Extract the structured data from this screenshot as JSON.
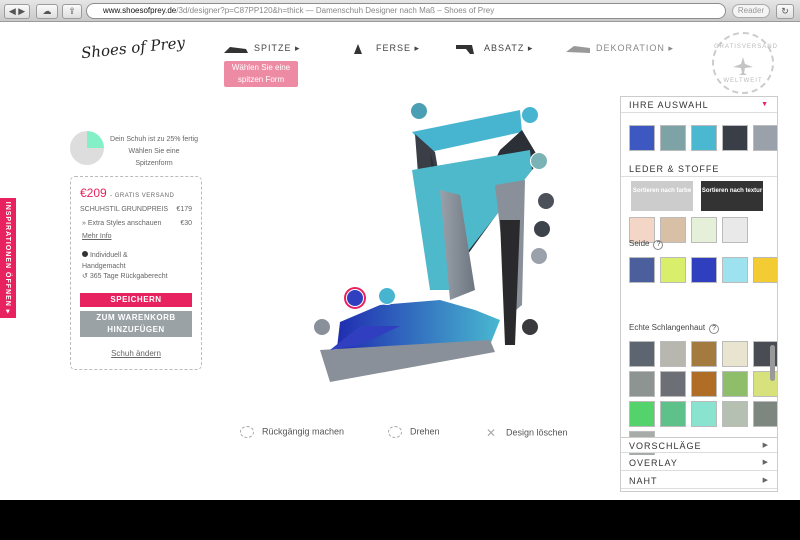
{
  "browser": {
    "url_domain": "www.shoesofprey.de",
    "url_path": "/3d/designer?p=C87PP120&h=thick",
    "page_title": "— Damenschuh Designer nach Maß – Shoes of Prey",
    "reader_label": "Reader"
  },
  "logo": {
    "text": "Shoes of Prey"
  },
  "steps": [
    {
      "label": "SPITZE ▸"
    },
    {
      "label": "FERSE ▸"
    },
    {
      "label": "ABSATZ ▸"
    },
    {
      "label": "DEKORATION ▸"
    }
  ],
  "hint": {
    "line1": "Wählen Sie eine",
    "line2": "spitzen Form"
  },
  "stamp": {
    "top": "GRATISVERSAND",
    "bottom": "WELTWEIT"
  },
  "sidetab": {
    "label": "INSPIRATIONEN ÖFFNEN ▸"
  },
  "progress": {
    "line1": "Dein Schuh ist zu 25% fertig",
    "line2": "Wählen Sie eine",
    "line3": "Spitzenform",
    "fraction": 0.25
  },
  "summary": {
    "price": "€209",
    "shipping": "- GRATIS VERSAND",
    "base_label": "SCHUHSTIL GRUNDPREIS",
    "base_price": "€179",
    "extra_label": "» Extra Styles anschauen",
    "extra_price": "€30",
    "more_info": "Mehr Info",
    "feature1a": "Individuell &",
    "feature1b": "Handgemacht",
    "feature2": "365 Tage Rückgaberecht",
    "save_label": "SPEICHERN",
    "cart_label1": "ZUM WARENKORB",
    "cart_label2": "HINZUFÜGEN",
    "change_label": "Schuh ändern"
  },
  "actions": {
    "undo": "Rückgängig machen",
    "rotate": "Drehen",
    "delete": "Design löschen"
  },
  "panel": {
    "selection_title": "IHRE AUSWAHL",
    "materials_title": "LEDER & STOFFE",
    "sort_color": "Sortieren nach farbe",
    "sort_texture": "Sortieren nach textur",
    "silk_label": "Seide",
    "snake_label": "Echte Schlangenhaut",
    "suggestions": "VORSCHLÄGE",
    "overlay": "OVERLAY",
    "seam": "NAHT",
    "selection_colors": [
      "#3e58c2",
      "#7ea3a6",
      "#49b8d0",
      "#3a3f47",
      "#9aa1ab"
    ],
    "leather_colors": [
      "#f3d6c6",
      "#d8c0a6",
      "#e6efd8",
      "#e9e9e9"
    ],
    "silk_colors": [
      "#4b5f9c",
      "#d9ef6b",
      "#2f3fc0",
      "#9fe2ef",
      "#f3cc33"
    ],
    "snake_colors": [
      "#5d6670",
      "#b7b7b0",
      "#a37b3e",
      "#e9e4d0",
      "#4a4c54",
      "#8d9492",
      "#6d6f77",
      "#b06d26",
      "#8fbe6b",
      "#d8e27d",
      "#54d26b",
      "#5fc18a",
      "#89e3cf",
      "#b5bfb2",
      "#7d8780",
      "#a7aca9"
    ]
  },
  "hotspot_colors": [
    "#4a9fb4",
    "#48b5d0",
    "#7ab2b5",
    "#4b5059",
    "#3d424b",
    "#9aa1ab",
    "#3a3a3d",
    "#48b5d0",
    "#2f3fc0",
    "#8a9099"
  ]
}
